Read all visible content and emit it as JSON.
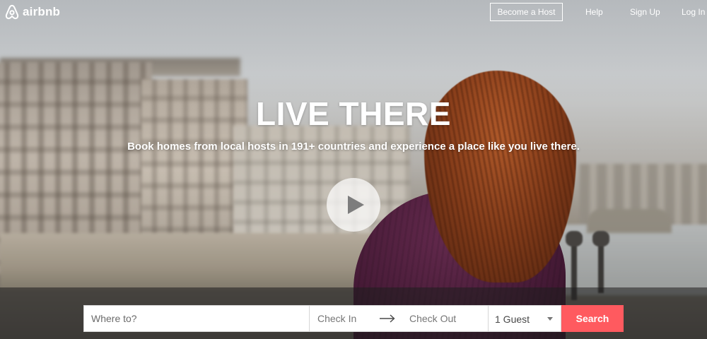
{
  "brand": {
    "name": "airbnb",
    "logo_icon": "belo-icon",
    "accent_color": "#ff5a5f"
  },
  "header": {
    "become_host": "Become a Host",
    "help": "Help",
    "sign_up": "Sign Up",
    "log_in": "Log In"
  },
  "hero": {
    "headline": "LIVE THERE",
    "subtitle": "Book homes from local hosts in 191+ countries and experience a place like you live there.",
    "play_icon": "play-icon"
  },
  "search": {
    "where_placeholder": "Where to?",
    "check_in": "Check In",
    "arrow_icon": "arrow-right-icon",
    "check_out": "Check Out",
    "guests": "1 Guest",
    "search_button": "Search"
  }
}
